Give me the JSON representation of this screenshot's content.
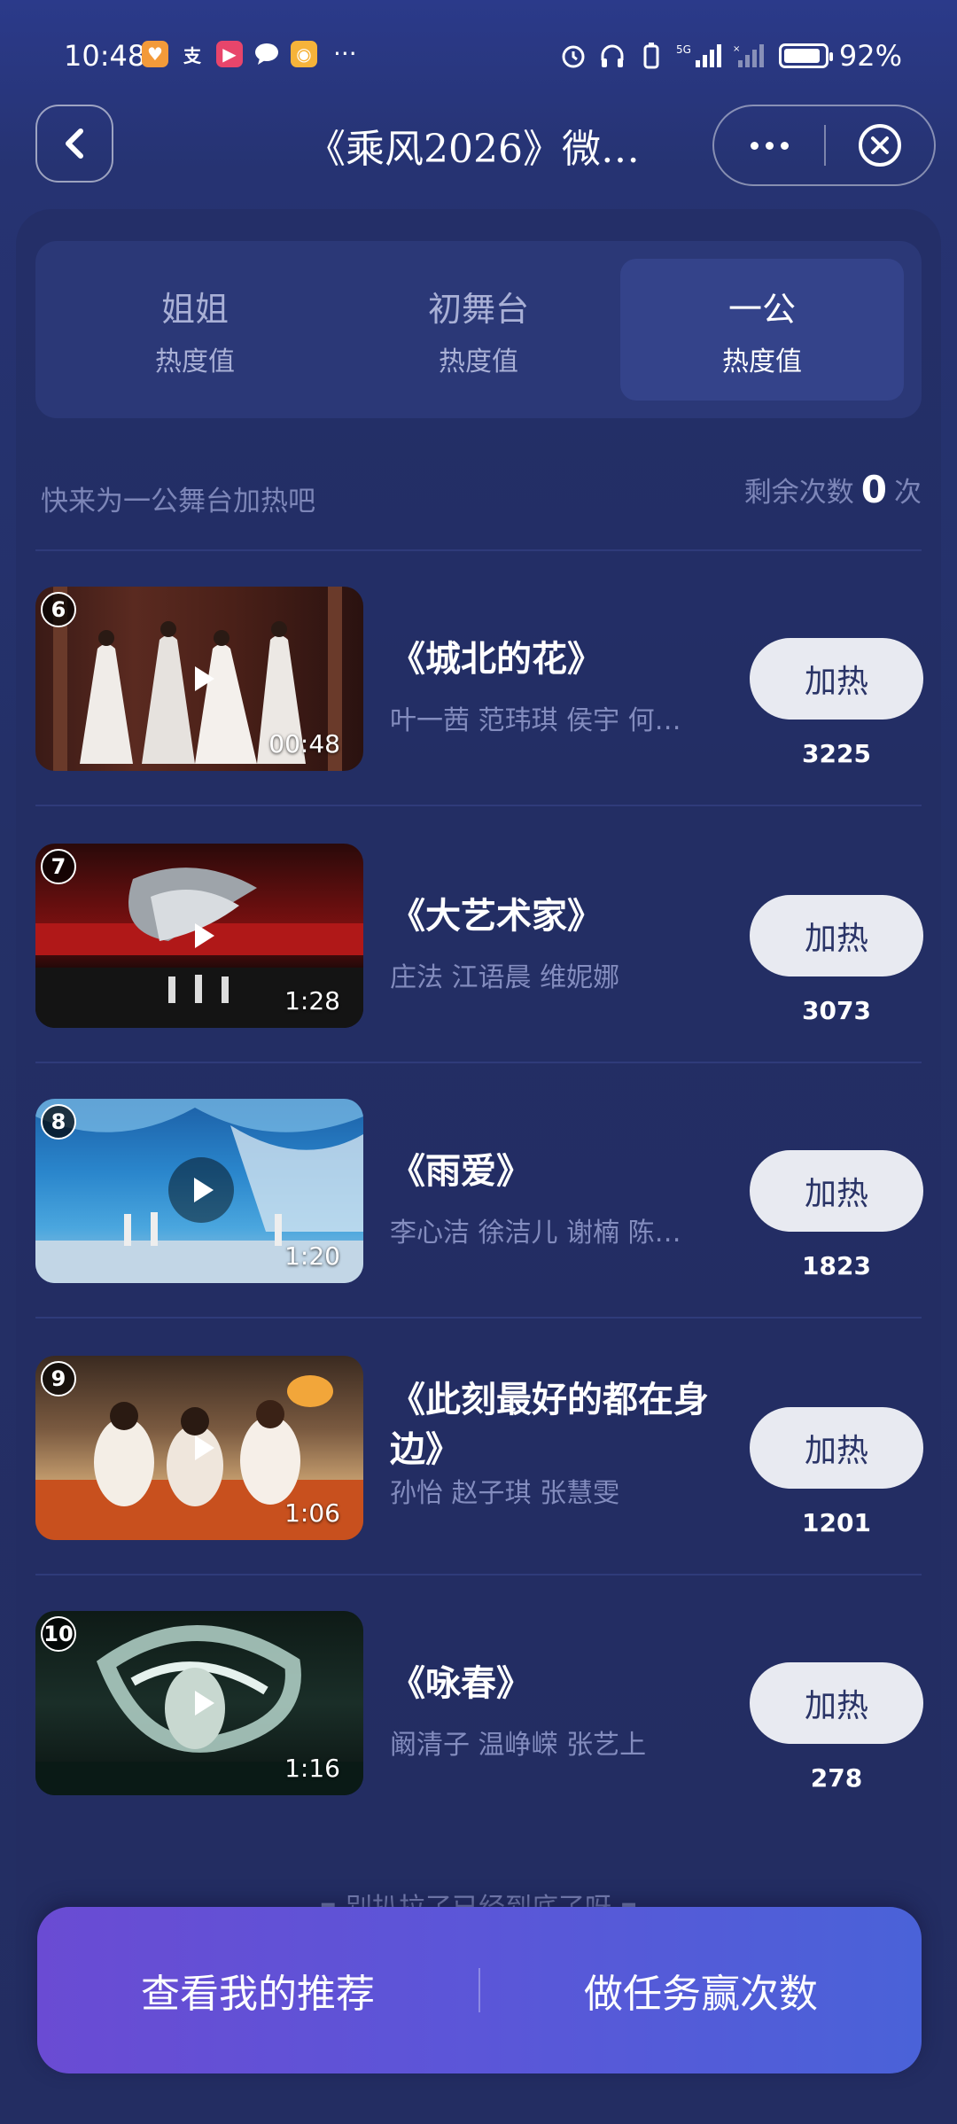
{
  "status_bar": {
    "time": "10:48",
    "network": "5G",
    "battery_percent": "92%",
    "battery_level": 0.92,
    "app_icons": [
      {
        "name": "heart-app-icon",
        "color": "#f39a3a"
      },
      {
        "name": "alipay-icon",
        "color": "#ffffff",
        "glyph": "支"
      },
      {
        "name": "video-app-icon",
        "color": "#e8456b"
      },
      {
        "name": "chat-app-icon",
        "color": "#ffffff"
      },
      {
        "name": "camera-app-icon",
        "color": "#f6b33a"
      }
    ]
  },
  "header": {
    "title": "《乘风2026》微…"
  },
  "tabs": [
    {
      "main": "姐姐",
      "sub": "热度值",
      "active": false
    },
    {
      "main": "初舞台",
      "sub": "热度值",
      "active": false
    },
    {
      "main": "一公",
      "sub": "热度值",
      "active": true
    }
  ],
  "info": {
    "hint": "快来为一公舞台加热吧",
    "remaining_prefix": "剩余次数",
    "remaining_count": "0",
    "remaining_suffix": "次"
  },
  "items": [
    {
      "rank": "6",
      "title": "《城北的花》",
      "artists": "叶一茜 范玮琪 侯宇 何…",
      "duration": "00:48",
      "button": "加热",
      "heat": "3225"
    },
    {
      "rank": "7",
      "title": "《大艺术家》",
      "artists": "庄法 江语晨 维妮娜",
      "duration": "1:28",
      "button": "加热",
      "heat": "3073"
    },
    {
      "rank": "8",
      "title": "《雨爱》",
      "artists": "李心洁 徐洁儿 谢楠 陈…",
      "duration": "1:20",
      "button": "加热",
      "heat": "1823"
    },
    {
      "rank": "9",
      "title": "《此刻最好的都在身边》",
      "artists": "孙怡 赵子琪 张慧雯",
      "duration": "1:06",
      "button": "加热",
      "heat": "1201"
    },
    {
      "rank": "10",
      "title": "《咏春》",
      "artists": "阚清子 温峥嵘 张艺上",
      "duration": "1:16",
      "button": "加热",
      "heat": "278"
    }
  ],
  "end_note": "▪ 别扒拉了已经到底了呀 ▪",
  "bottom": {
    "left": "查看我的推荐",
    "right": "做任务赢次数"
  },
  "colors": {
    "background": "#243067",
    "tab_active": "#34438a",
    "button": "#e8eaf1",
    "bottom_bar": "#5b56d8"
  }
}
